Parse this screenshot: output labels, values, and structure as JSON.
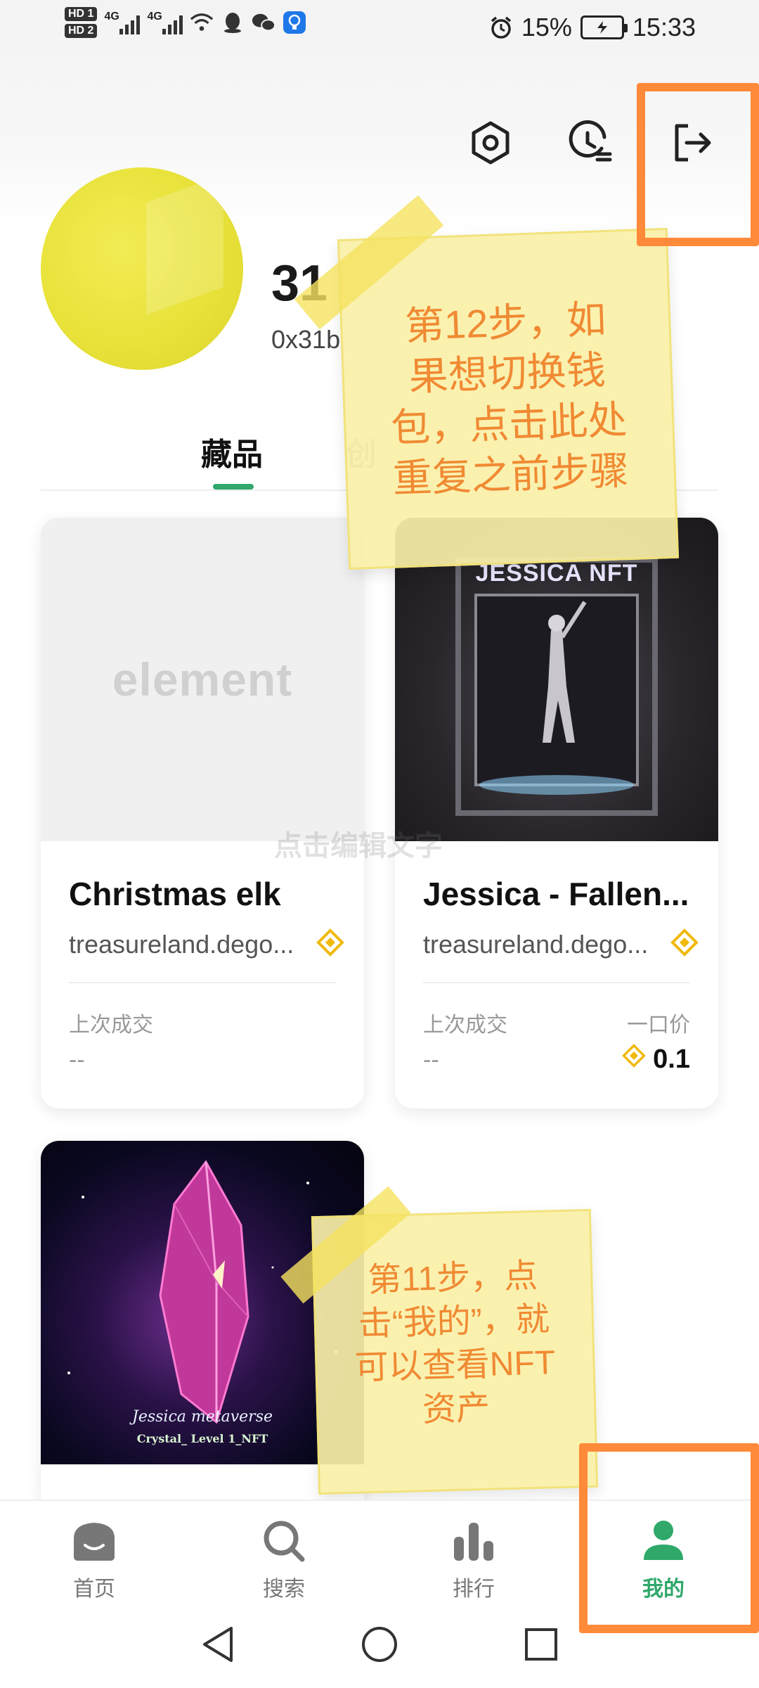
{
  "status_bar": {
    "hd1": "HD 1",
    "hd2": "HD 2",
    "net1": "4G",
    "net2": "4G",
    "battery": "15%",
    "time": "15:33"
  },
  "header": {
    "icons": [
      "settings-hex-icon",
      "history-clock-icon",
      "logout-icon"
    ]
  },
  "profile": {
    "name": "31",
    "address": "0x31b"
  },
  "tabs": [
    {
      "label": "藏品",
      "active": true
    },
    {
      "label": "创",
      "active": false
    }
  ],
  "cards": [
    {
      "title": "Christmas elk",
      "collection": "treasureland.dego...",
      "image_text": "element",
      "last_sale_label": "上次成交",
      "last_sale_value": "--",
      "price_label": "",
      "price_value": ""
    },
    {
      "title": "Jessica - Fallen...",
      "collection": "treasureland.dego...",
      "image_text": "JESSICA NFT",
      "last_sale_label": "上次成交",
      "last_sale_value": "--",
      "price_label": "一口价",
      "price_value": "0.1"
    },
    {
      "image_text_1": "Jessica metaverse",
      "image_text_2": "Crystal_ Level 1_NFT"
    }
  ],
  "watermark": "点击编辑文字",
  "notes": {
    "step12": [
      "第12步，如",
      "果想切换钱",
      "包，点击此处",
      "重复之前步骤"
    ],
    "step11": [
      "第11步，点",
      "击“我的”，就",
      "可以查看NFT",
      "资产"
    ]
  },
  "bottom_nav": [
    {
      "label": "首页",
      "icon": "home-icon",
      "active": false
    },
    {
      "label": "搜索",
      "icon": "search-icon",
      "active": false
    },
    {
      "label": "排行",
      "icon": "ranking-icon",
      "active": false
    },
    {
      "label": "我的",
      "icon": "profile-icon",
      "active": true
    }
  ],
  "colors": {
    "accent": "#2fa86a",
    "highlight": "#ff8a3a",
    "note_text": "#f08a33",
    "bnb": "#f0b90b"
  }
}
